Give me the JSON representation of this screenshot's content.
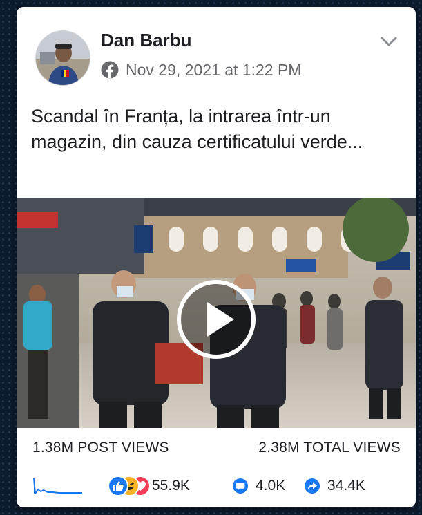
{
  "post": {
    "author": "Dan Barbu",
    "date": "Nov 29, 2021 at 1:22 PM",
    "text": "Scandal în Franța, la intrarea într-un magazin, din cauza certificatului verde..."
  },
  "stats": {
    "post_views": "1.38M POST VIEWS",
    "total_views": "2.38M TOTAL VIEWS"
  },
  "engagement": {
    "reactions": "55.9K",
    "comments": "4.0K",
    "shares": "34.4K"
  },
  "icons": {
    "platform": "facebook-icon",
    "menu": "chevron-down-icon",
    "video": "play-icon",
    "trend": "sparkline-icon",
    "reactions": [
      "like-icon",
      "haha-icon",
      "love-icon"
    ],
    "comments": "comment-icon",
    "shares": "share-icon"
  },
  "colors": {
    "facebook_blue": "#1877f2",
    "love_red": "#f33e58",
    "haha_yellow": "#f7b125",
    "text": "#1c1e21",
    "secondary_text": "#65676b"
  }
}
